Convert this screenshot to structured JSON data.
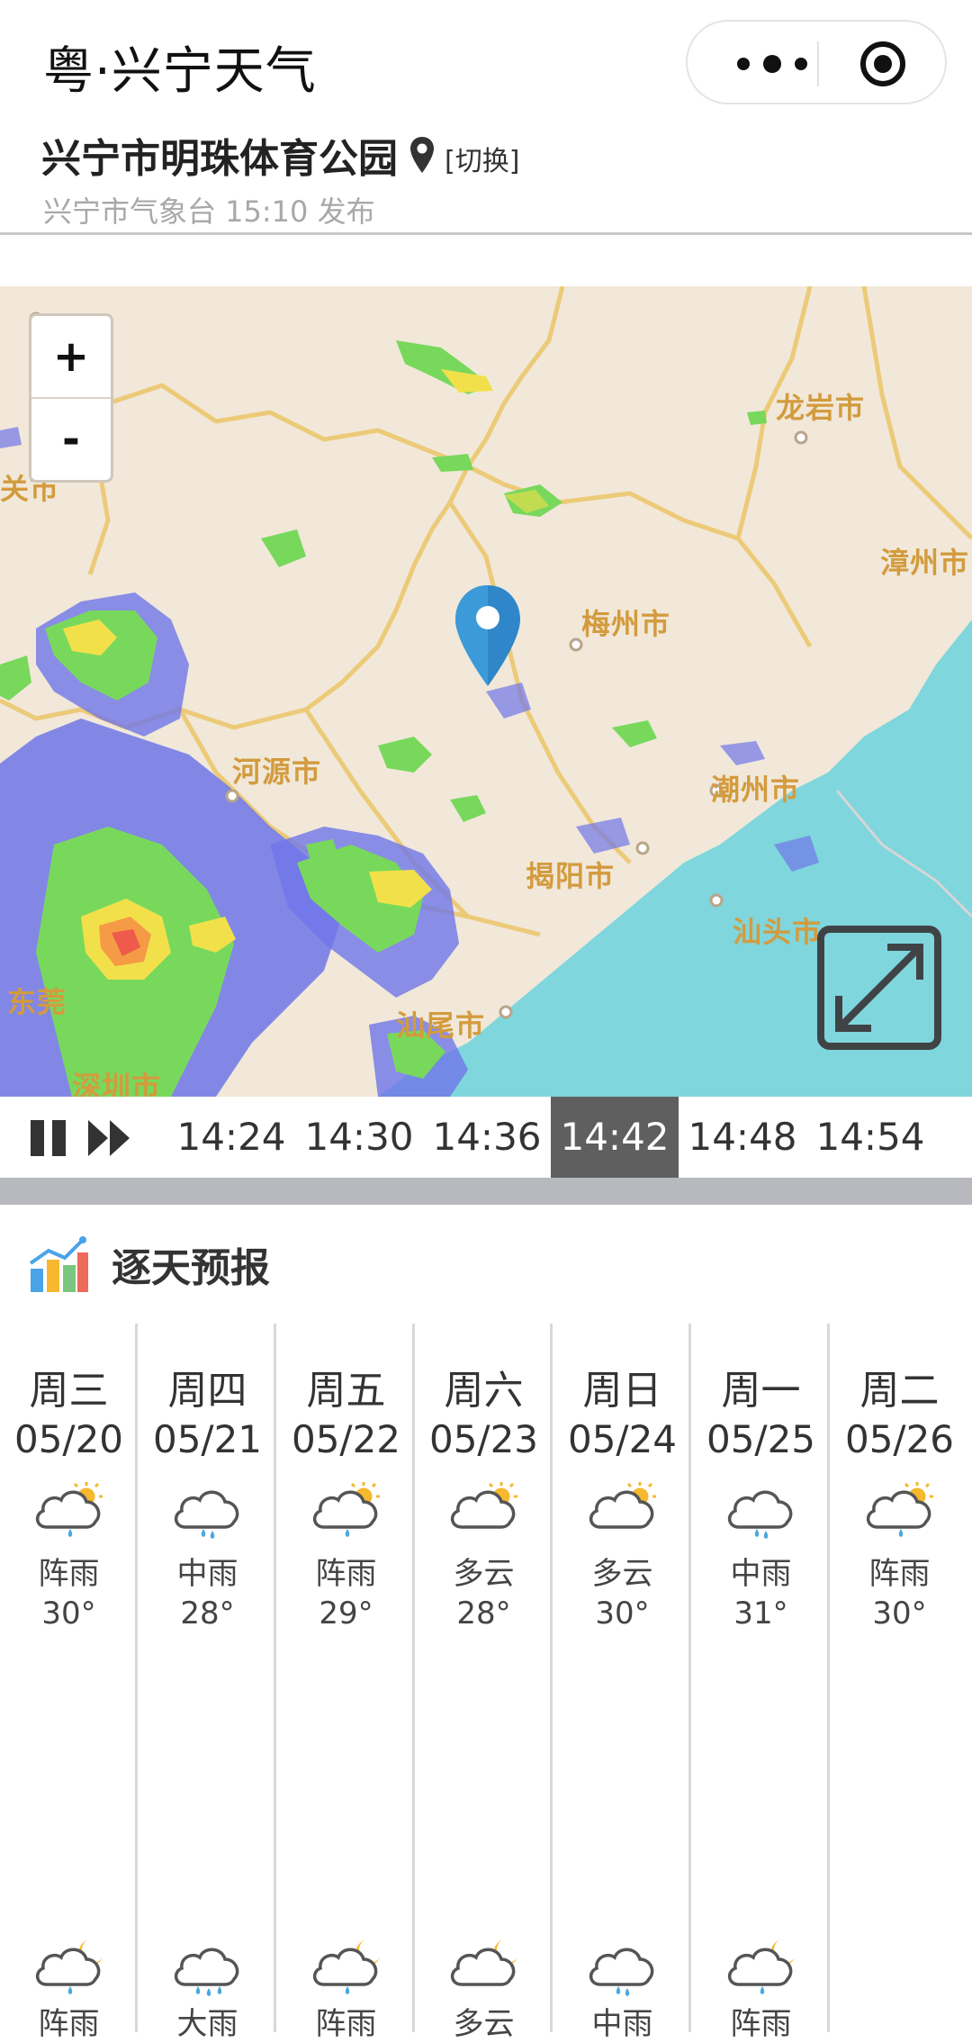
{
  "app": {
    "title": "粤·兴宁天气"
  },
  "location": {
    "name": "兴宁市明珠体育公园",
    "switch_label": "[切换]",
    "publisher": "兴宁市气象台 15:10 发布"
  },
  "map": {
    "zoom_in": "+",
    "zoom_out": "-",
    "cities": {
      "longyan": "龙岩市",
      "zhangzhou": "漳州市",
      "meizhou": "梅州市",
      "heyuan": "河源市",
      "chaozhou": "潮州市",
      "jieyang": "揭阳市",
      "shantou": "汕头市",
      "shanwei": "汕尾市",
      "dongguan": "东莞",
      "shenzhen": "深圳市",
      "shaoguan": "关市"
    }
  },
  "timeline": {
    "times": [
      "14:24",
      "14:30",
      "14:36",
      "14:42",
      "14:48",
      "14:54"
    ],
    "active": "14:42"
  },
  "forecast": {
    "title": "逐天预报",
    "days": [
      {
        "name": "周三",
        "date": "05/20",
        "day_icon": "shower-day-icon",
        "day_cond": "阵雨",
        "high": "30°",
        "night_icon": "shower-night-icon",
        "night_cond": "阵雨"
      },
      {
        "name": "周四",
        "date": "05/21",
        "day_icon": "moderate-rain-icon",
        "day_cond": "中雨",
        "high": "28°",
        "night_icon": "heavy-rain-icon",
        "night_cond": "大雨"
      },
      {
        "name": "周五",
        "date": "05/22",
        "day_icon": "shower-day-icon",
        "day_cond": "阵雨",
        "high": "29°",
        "night_icon": "shower-night-icon",
        "night_cond": "阵雨"
      },
      {
        "name": "周六",
        "date": "05/23",
        "day_icon": "cloudy-day-icon",
        "day_cond": "多云",
        "high": "28°",
        "night_icon": "cloudy-night-icon",
        "night_cond": "多云"
      },
      {
        "name": "周日",
        "date": "05/24",
        "day_icon": "cloudy-day-icon",
        "day_cond": "多云",
        "high": "30°",
        "night_icon": "moderate-rain-icon",
        "night_cond": "中雨"
      },
      {
        "name": "周一",
        "date": "05/25",
        "day_icon": "moderate-rain-icon",
        "day_cond": "中雨",
        "high": "31°",
        "night_icon": "shower-night-icon",
        "night_cond": "阵雨"
      },
      {
        "name": "周二",
        "date": "05/26",
        "day_icon": "shower-day-icon",
        "day_cond": "阵雨",
        "high": "30°",
        "night_icon": "",
        "night_cond": ""
      }
    ]
  },
  "colors": {
    "map_land": "#f1e8d9",
    "map_sea": "#7fd6dc",
    "border": "#ecca78",
    "radar_blue": "#6f76e8",
    "radar_green": "#78d85c",
    "radar_yellow": "#f2e04a",
    "radar_red": "#ee5a4c",
    "active_time": "#5f5f5f",
    "pin": "#2f87c9",
    "sun": "#f5b82e",
    "rain": "#4aa8e0"
  }
}
